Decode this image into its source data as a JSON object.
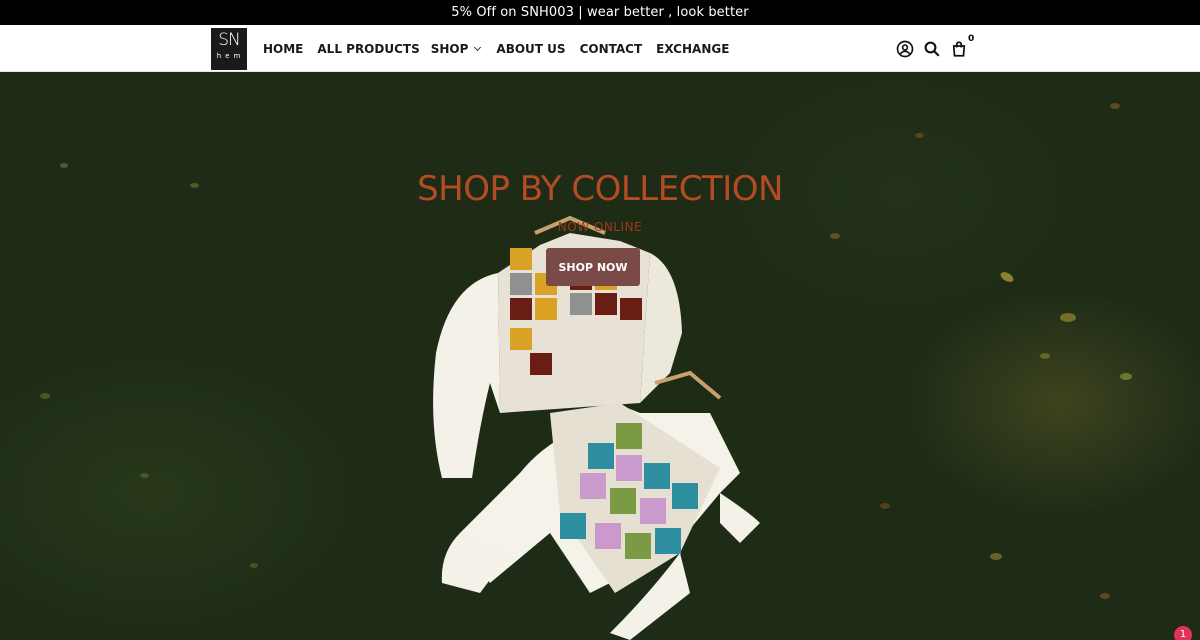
{
  "announcement": "5% Off on SNH003 | wear better , look better",
  "logo": {
    "line1": "SN",
    "line2": "hem"
  },
  "nav": {
    "home": "HOME",
    "all_products": "ALL PRODUCTS",
    "shop": "SHOP",
    "about": "ABOUT US",
    "contact": "CONTACT",
    "exchange": "EXCHANGE"
  },
  "header_icons": [
    "account-icon",
    "search-icon",
    "cart-icon"
  ],
  "cart_count": "0",
  "hero": {
    "title": "SHOP BY COLLECTION",
    "subtitle": "NOW ONLINE",
    "button": "SHOP NOW",
    "title_color": "#b54b22",
    "button_color": "#7a4a47"
  },
  "chat_badge": "1"
}
